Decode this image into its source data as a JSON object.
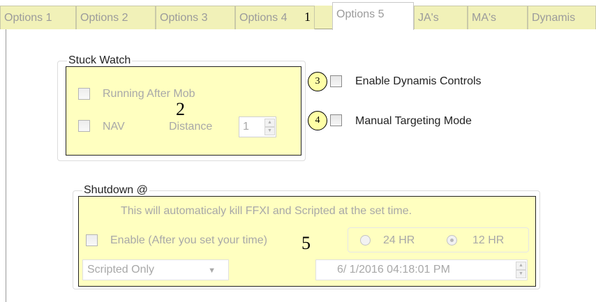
{
  "tabs": [
    {
      "label": "Options 1"
    },
    {
      "label": "Options 2"
    },
    {
      "label": "Options 3"
    },
    {
      "label": "Options 4"
    },
    {
      "label": "Options 5"
    },
    {
      "label": "JA's"
    },
    {
      "label": "MA's"
    },
    {
      "label": "Dynamis"
    }
  ],
  "active_tab": "Options 5",
  "markers": {
    "m1": "1",
    "m2": "2",
    "m3": "3",
    "m4": "4",
    "m5": "5"
  },
  "stuck_watch": {
    "title": "Stuck Watch",
    "running_after_mob": "Running After Mob",
    "nav": "NAV",
    "distance_label": "Distance",
    "distance_value": "1"
  },
  "dynamis": {
    "enable_controls": "Enable Dynamis Controls",
    "manual_targeting": "Manual Targeting Mode"
  },
  "shutdown": {
    "title": "Shutdown @",
    "info": "This will automaticaly kill FFXI and Scripted at the set time.",
    "enable_label": "Enable (After you set your time)",
    "radio_24": "24 HR",
    "radio_12": "12 HR",
    "mode_value": "Scripted Only",
    "datetime_value": "6/  1/2016 04:18:01 PM"
  },
  "colors": {
    "highlight": "#ffff8c",
    "tab_bg": "#f1f1b8",
    "disabled_text": "#a8a8a8"
  }
}
